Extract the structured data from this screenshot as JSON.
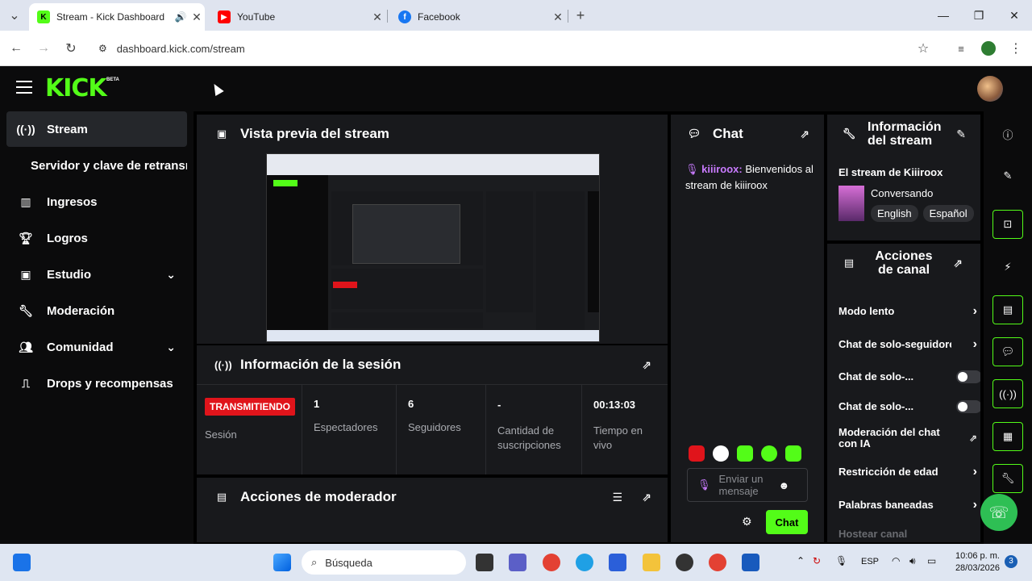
{
  "browser": {
    "tabs": [
      {
        "title": "Stream - Kick Dashboard",
        "favicon": "kick-icon",
        "color": "#53fc18"
      },
      {
        "title": "YouTube",
        "favicon": "youtube-icon",
        "color": "#ff0000"
      },
      {
        "title": "Facebook",
        "favicon": "facebook-icon",
        "color": "#1877f2"
      }
    ],
    "url": "dashboard.kick.com/stream"
  },
  "kick": {
    "logo": "KICK",
    "beta": "BETA"
  },
  "sidebar": {
    "items": [
      {
        "label": "Stream",
        "icon": "broadcast-icon"
      },
      {
        "label": "Servidor y clave de retransmisión",
        "icon": ""
      },
      {
        "label": "Ingresos",
        "icon": "chart-icon"
      },
      {
        "label": "Logros",
        "icon": "trophy-icon"
      },
      {
        "label": "Estudio",
        "icon": "studio-icon"
      },
      {
        "label": "Moderación",
        "icon": "wrench-icon"
      },
      {
        "label": "Comunidad",
        "icon": "community-icon"
      },
      {
        "label": "Drops y recompensas",
        "icon": "drops-icon"
      }
    ]
  },
  "preview": {
    "title": "Vista previa del stream"
  },
  "session": {
    "title": "Información de la sesión",
    "badge": "TRANSMITIENDO",
    "session_label": "Sesión",
    "stats": [
      {
        "value": "1",
        "label": "Espectadores"
      },
      {
        "value": "6",
        "label": "Seguidores"
      },
      {
        "value": "-",
        "label": "Cantidad de suscripciones"
      },
      {
        "value": "00:13:03",
        "label": "Tiempo en vivo"
      }
    ]
  },
  "mod_actions": {
    "title": "Acciones de moderador"
  },
  "chat": {
    "title": "Chat",
    "message_user": "kiiiroox:",
    "message_text": " Bienvenidos al stream de kiiiroox",
    "input_placeholder": "Enviar un mensaje",
    "send_label": "Chat"
  },
  "stream_info": {
    "title": "Información del stream",
    "stream_title": "El stream de Kiiiroox",
    "category": "Conversando",
    "tags": [
      "English",
      "Español"
    ]
  },
  "channel_actions": {
    "title": "Acciones de canal",
    "rows": [
      {
        "label": "Modo lento"
      },
      {
        "label": "Chat de solo-seguidores"
      },
      {
        "label": "Chat de solo-..."
      },
      {
        "label": "Chat de solo-..."
      },
      {
        "label": "Moderación del chat con IA"
      },
      {
        "label": "Restricción de edad"
      },
      {
        "label": "Palabras baneadas"
      },
      {
        "label": "Hostear canal"
      }
    ]
  },
  "taskbar": {
    "search_placeholder": "Búsqueda",
    "lang": "ESP",
    "time": "10:06 p. m.",
    "date": "28/03/2026",
    "notif_count": "3"
  }
}
